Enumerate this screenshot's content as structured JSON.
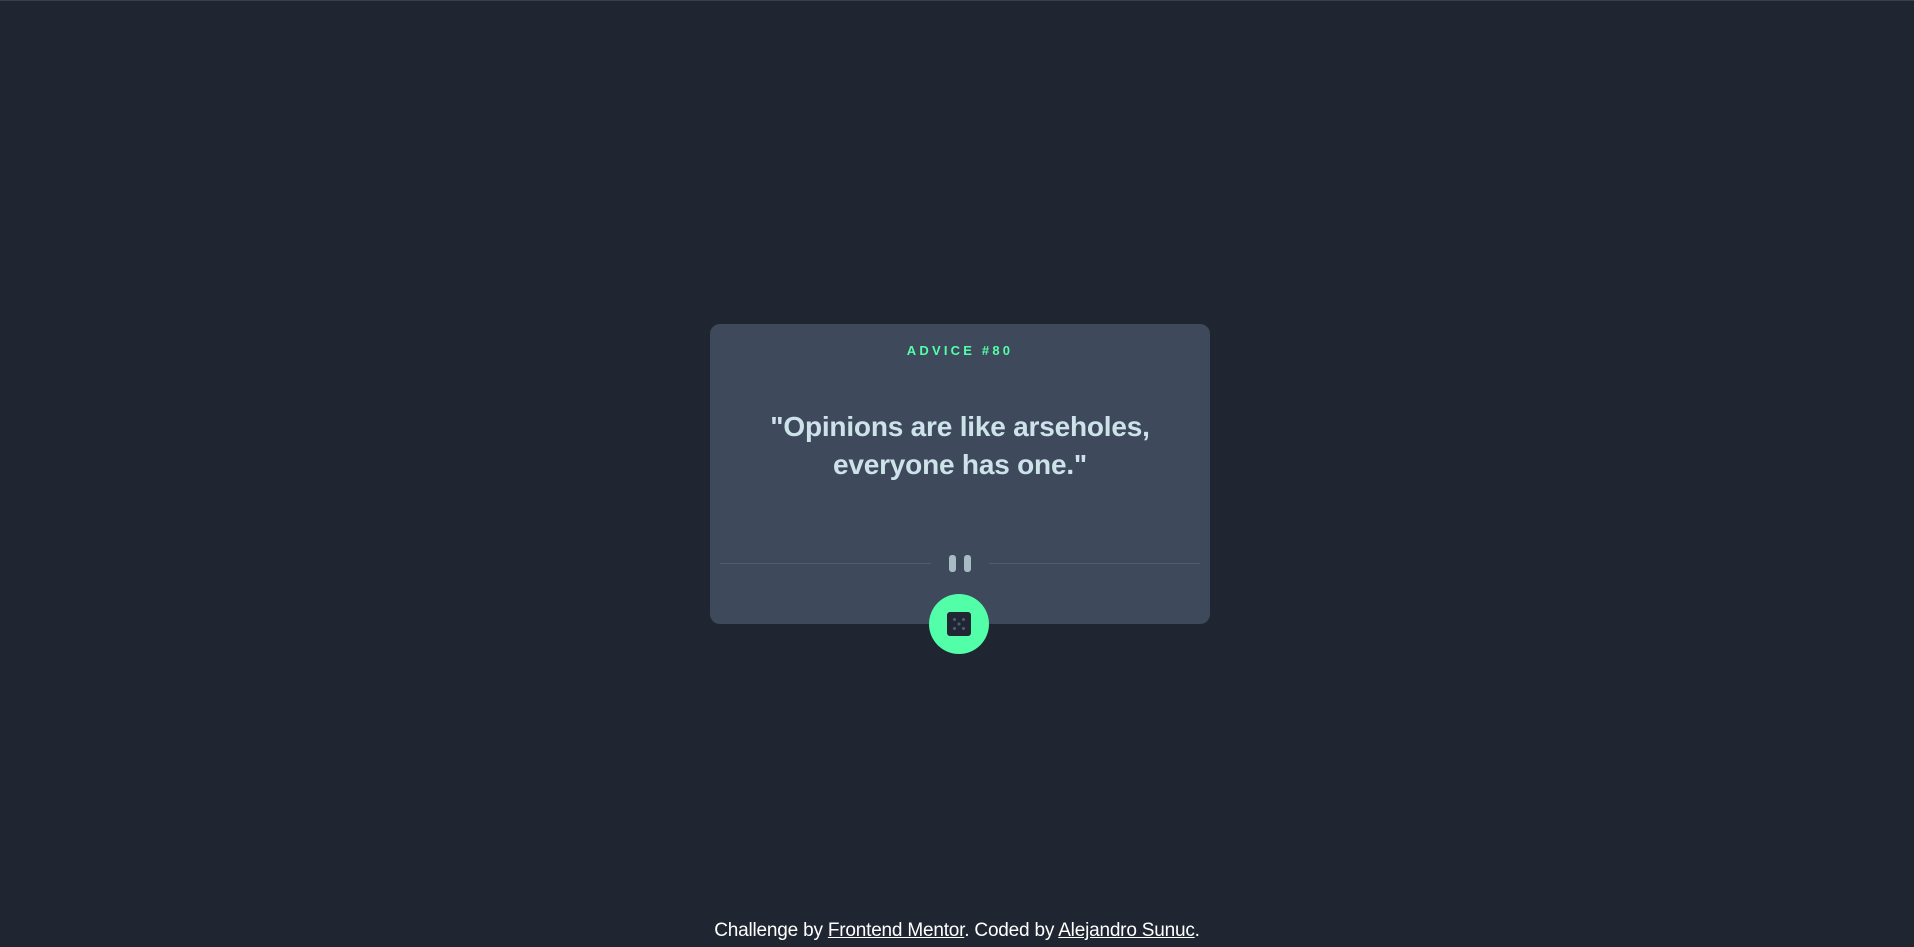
{
  "card": {
    "advice_label": "ADVICE #80",
    "quote": "\"Opinions are like arseholes, everyone has one.\""
  },
  "dice_button": {
    "icon": "dice-icon"
  },
  "divider": {
    "icon": "pause-icon"
  },
  "footer": {
    "challenge_prefix": "Challenge by ",
    "challenge_link": "Frontend Mentor",
    "coded_prefix": ". Coded by ",
    "coded_link": "Alejandro Sunuc",
    "suffix": "."
  },
  "colors": {
    "background": "#1f2632",
    "card": "#3e4a5c",
    "accent": "#52ffa8",
    "quote_text": "#cee3e9",
    "divider": "#4f5d73"
  }
}
